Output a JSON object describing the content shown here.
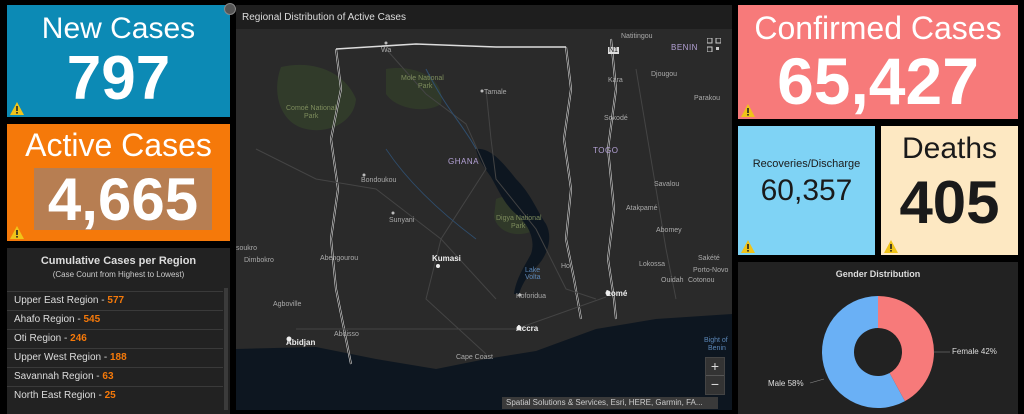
{
  "new_cases": {
    "title": "New Cases",
    "value": "797"
  },
  "active_cases": {
    "title": "Active Cases",
    "value": "4,665"
  },
  "cumulative": {
    "title": "Cumulative Cases per Region",
    "subtitle": "(Case Count from Highest to Lowest)",
    "rows": [
      {
        "name": "Upper East Region - ",
        "count": "577"
      },
      {
        "name": "Ahafo Region - ",
        "count": "545"
      },
      {
        "name": "Oti Region - ",
        "count": "246"
      },
      {
        "name": "Upper West Region - ",
        "count": "188"
      },
      {
        "name": "Savannah Region - ",
        "count": "63"
      },
      {
        "name": "North East Region - ",
        "count": "25"
      }
    ]
  },
  "map": {
    "title": "Regional Distribution of Active Cases",
    "attribution": "Spatial Solutions & Services, Esri, HERE, Garmin, FA...",
    "zoom_in": "+",
    "zoom_out": "−",
    "labels": {
      "wa": "Wa",
      "natitingou": "Natitingou",
      "benin": "BENIN",
      "n1": "N1",
      "mole": "Mole National",
      "mole2": "Park",
      "djougou": "Djougou",
      "kara": "Kara",
      "tamale": "Tamale",
      "parakou": "Parakou",
      "comoe": "Comoé National",
      "comoe2": "Park",
      "sokode": "Sokodé",
      "togo": "TOGO",
      "ghana": "GHANA",
      "bondoukou": "Bondoukou",
      "savalou": "Savalou",
      "sunyani": "Sunyani",
      "digya": "Digya National",
      "digya2": "Park",
      "atakpame": "Atakpamé",
      "abomey": "Abomey",
      "soukro": "soukro",
      "dimbokro": "Dimbokro",
      "abengourou": "Abengourou",
      "kumasi": "Kumasi",
      "lake": "Lake",
      "lake2": "Volta",
      "ho": "Ho",
      "lokossa": "Lokossa",
      "sakete": "Sakété",
      "portonovo": "Porto-Novo",
      "ouidah": "Ouidah",
      "cotonou": "Cotonou",
      "agboville": "Agboville",
      "koforidua": "Koforidua",
      "lome": "Lomé",
      "aboisso": "Aboisso",
      "accra": "Accra",
      "abidjan": "Abidjan",
      "capecoast": "Cape Coast",
      "bight": "Bight of",
      "bight2": "Benin"
    }
  },
  "confirmed": {
    "title": "Confirmed Cases",
    "value": "65,427"
  },
  "recoveries": {
    "title": "Recoveries/Discharge",
    "value": "60,357"
  },
  "deaths": {
    "title": "Deaths",
    "value": "405"
  },
  "gender": {
    "title": "Gender Distribution",
    "female_label": "Female 42%",
    "male_label": "Male 58%"
  },
  "chart_data": {
    "type": "pie",
    "title": "Gender Distribution",
    "labels": [
      "Female",
      "Male"
    ],
    "values": [
      42,
      58
    ],
    "colors": [
      "#f77a7a",
      "#6ab0f5"
    ]
  },
  "colors": {
    "new_cases": "#0c8ab5",
    "active_cases": "#f5790a",
    "confirmed": "#f77a7a",
    "recoveries": "#7fd3f5",
    "deaths": "#fde8c2",
    "warning": "#f0c419"
  }
}
